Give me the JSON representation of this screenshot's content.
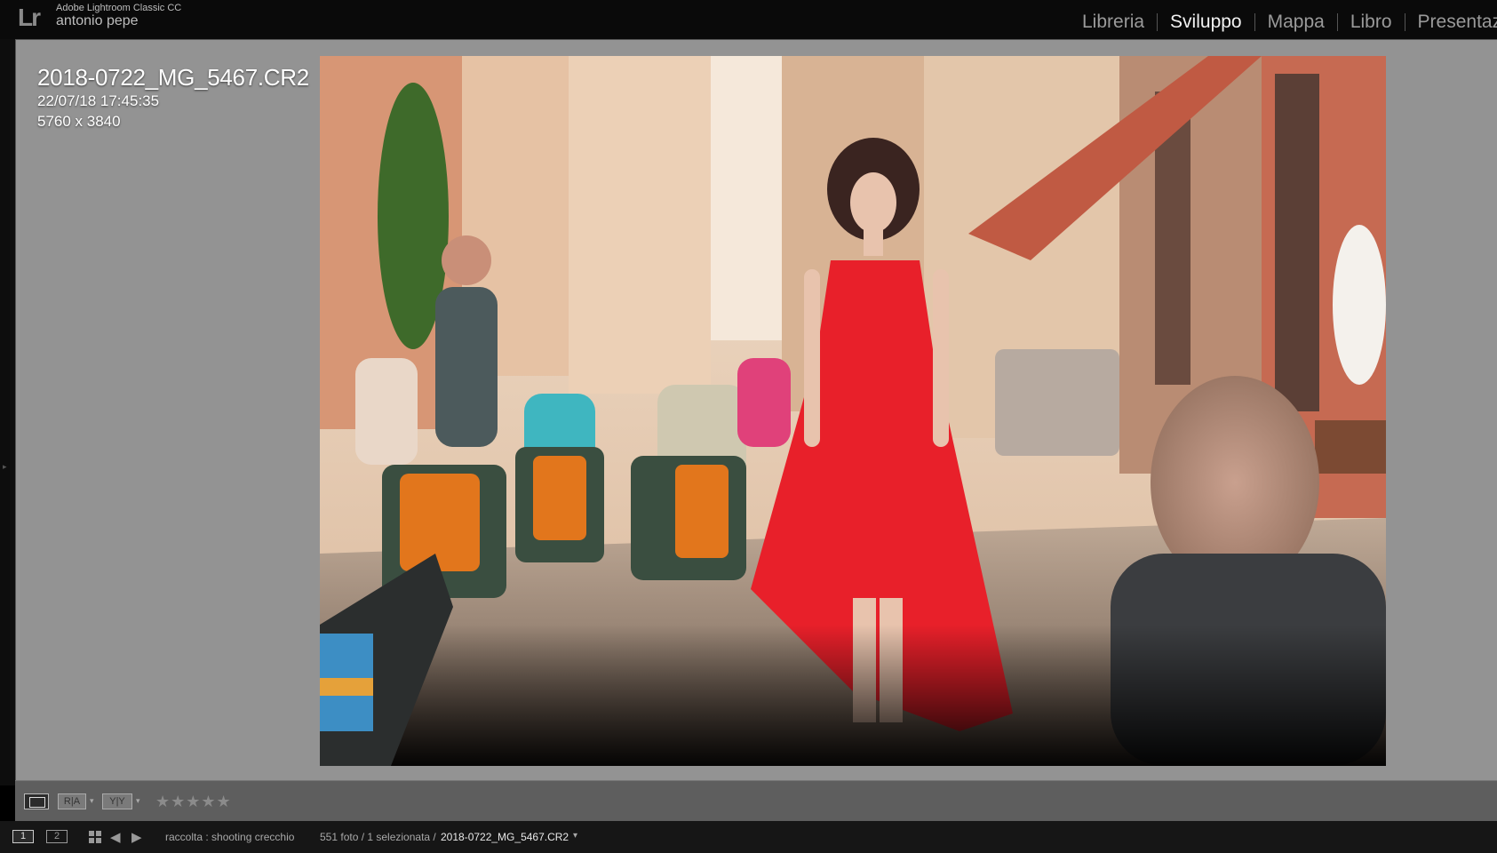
{
  "app": {
    "logo": "Lr",
    "name": "Adobe Lightroom Classic CC",
    "user": "antonio pepe"
  },
  "modules": [
    {
      "label": "Libreria",
      "active": false
    },
    {
      "label": "Sviluppo",
      "active": true
    },
    {
      "label": "Mappa",
      "active": false
    },
    {
      "label": "Libro",
      "active": false
    },
    {
      "label": "Presentaz",
      "active": false
    }
  ],
  "photo_info": {
    "filename": "2018-0722_MG_5467.CR2",
    "datetime": "22/07/18 17:45:35",
    "dimensions": "5760 x 3840"
  },
  "toolbar": {
    "ra_label": "R|A",
    "yy_label": "Y|Y",
    "stars": "★★★★★",
    "rating": 0
  },
  "filmstrip": {
    "screen1": "1",
    "screen2": "2",
    "source": "raccolta : shooting crecchio",
    "count": "551 foto / 1 selezionata /",
    "current_file": "2018-0722_MG_5467.CR2"
  },
  "icons": [
    "grid-icon",
    "arrow-left-icon",
    "arrow-right-icon",
    "caret-down-icon"
  ],
  "colors": {
    "panel_bg": "#939393",
    "toolbar_bg": "#5e5e5e",
    "dress_red": "#e8202a"
  }
}
